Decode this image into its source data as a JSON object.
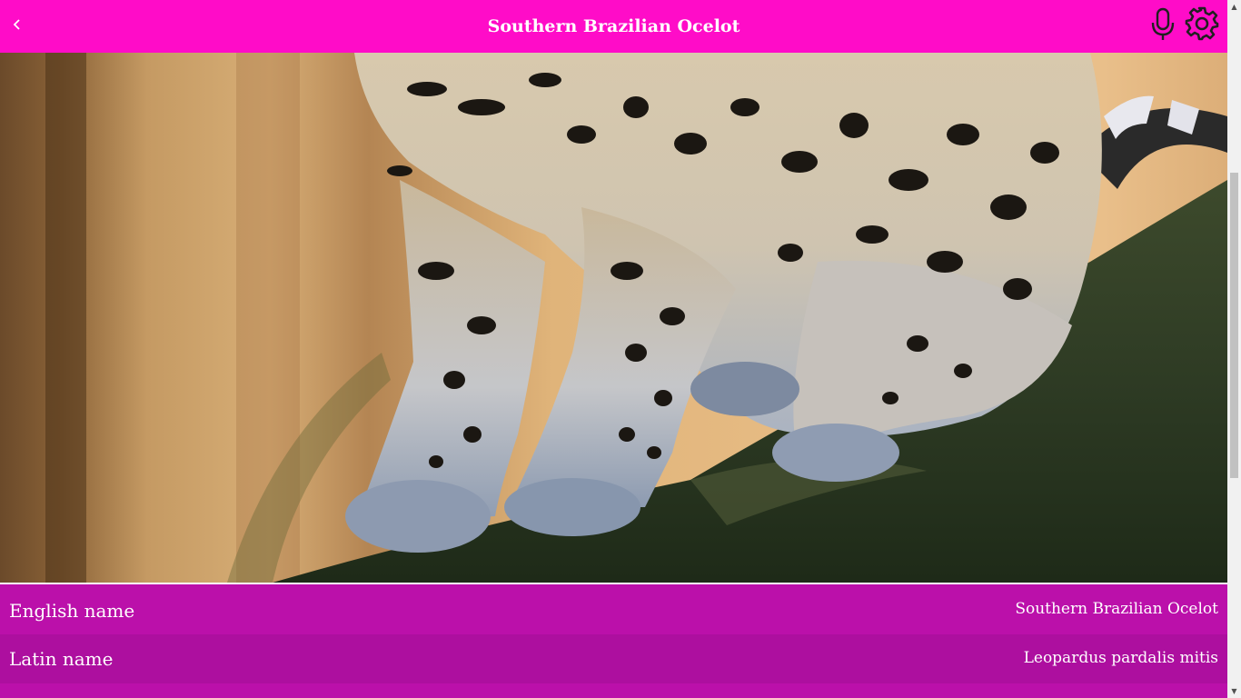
{
  "header": {
    "title": "Southern Brazilian Ocelot",
    "back_icon": "chevron-left-icon",
    "mic_icon": "microphone-icon",
    "settings_icon": "gear-icon"
  },
  "photo": {
    "subject": "ocelot-photo"
  },
  "details": [
    {
      "label": "English name",
      "value": "Southern Brazilian Ocelot"
    },
    {
      "label": "Latin name",
      "value": "Leopardus pardalis mitis"
    }
  ],
  "colors": {
    "header_bg": "#ff0cc8",
    "row_bg": "#bb10aa",
    "row_alt_bg": "#ad0f9f",
    "text": "#ffffff"
  }
}
